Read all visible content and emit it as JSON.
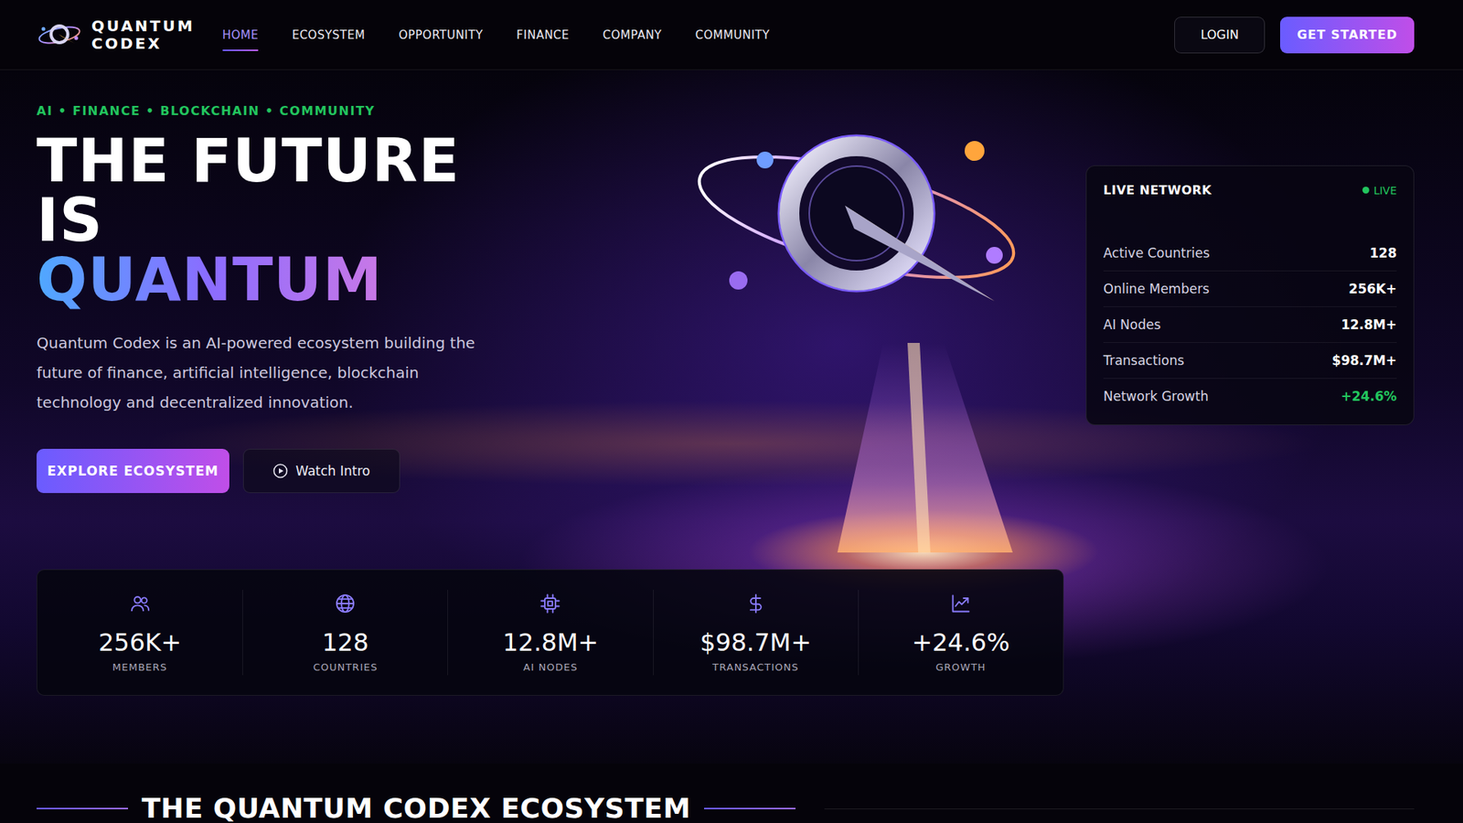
{
  "brand": {
    "line1": "QUANTUM",
    "line2": "CODEX"
  },
  "nav": [
    {
      "label": "HOME",
      "selected": true
    },
    {
      "label": "ECOSYSTEM",
      "selected": false
    },
    {
      "label": "OPPORTUNITY",
      "selected": false
    },
    {
      "label": "FINANCE",
      "selected": false
    },
    {
      "label": "COMPANY",
      "selected": false
    },
    {
      "label": "COMMUNITY",
      "selected": false
    }
  ],
  "actions": {
    "login": "LOGIN",
    "getStarted": "GET STARTED"
  },
  "hero": {
    "tagline": "AI • FINANCE • BLOCKCHAIN • COMMUNITY",
    "headlineLines": [
      "THE FUTURE",
      "IS"
    ],
    "highlight": "QUANTUM",
    "description": "Quantum Codex is an AI-powered ecosystem building the future of finance, artificial intelligence, blockchain technology and decentralized innovation.",
    "primaryButton": "EXPLORE ECOSYSTEM",
    "secondaryButton": "Watch Intro"
  },
  "liveNetwork": {
    "title": "LIVE NETWORK",
    "status": "LIVE",
    "live": true,
    "rows": [
      {
        "label": "Active Countries",
        "value": "128",
        "color": "#ffffff"
      },
      {
        "label": "Online Members",
        "value": "256K+",
        "color": "#ffffff"
      },
      {
        "label": "AI Nodes",
        "value": "12.8M+",
        "color": "#ffffff"
      },
      {
        "label": "Transactions",
        "value": "$98.7M+",
        "color": "#ffffff"
      },
      {
        "label": "Network Growth",
        "value": "+24.6%",
        "color": "#22c55e"
      }
    ]
  },
  "stats": [
    {
      "value": "256K+",
      "label": "MEMBERS"
    },
    {
      "value": "128",
      "label": "COUNTRIES"
    },
    {
      "value": "12.8M+",
      "label": "AI NODES"
    },
    {
      "value": "$98.7M+",
      "label": "TRANSACTIONS"
    },
    {
      "value": "+24.6%",
      "label": "GROWTH"
    }
  ],
  "section": {
    "title": "THE QUANTUM CODEX ECOSYSTEM"
  }
}
